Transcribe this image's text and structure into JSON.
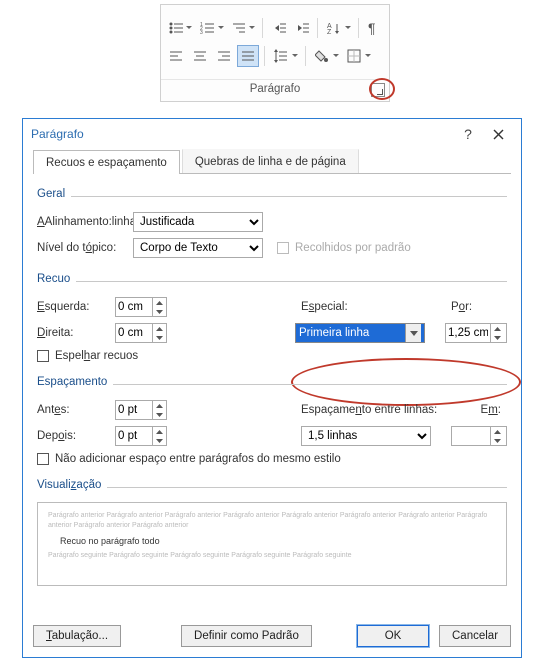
{
  "ribbon": {
    "group_label": "Parágrafo"
  },
  "dialog": {
    "title": "Parágrafo",
    "tabs": {
      "indent": "Recuos e espaçamento",
      "breaks": "Quebras de linha e de página"
    },
    "general": {
      "label": "Geral",
      "align_label": "Alinhamento:",
      "align_value": "Justificada",
      "outline_label": "Nível do tópico:",
      "outline_value": "Corpo de Texto",
      "collapsed_label": "Recolhidos por padrão"
    },
    "indent": {
      "label": "Recuo",
      "left_label": "Esquerda:",
      "left_value": "0 cm",
      "right_label": "Direita:",
      "right_value": "0 cm",
      "special_label": "Especial:",
      "special_value": "Primeira linha",
      "by_label": "Por:",
      "by_value": "1,25 cm",
      "mirror_label": "Espelhar recuos"
    },
    "spacing": {
      "label": "Espaçamento",
      "before_label": "Antes:",
      "before_value": "0 pt",
      "after_label": "Depois:",
      "after_value": "0 pt",
      "line_label": "Espaçamento entre linhas:",
      "line_value": "1,5 linhas",
      "at_label": "Em:",
      "at_value": "",
      "no_space_label": "Não adicionar espaço entre parágrafos do mesmo estilo"
    },
    "preview": {
      "label": "Visualização",
      "prev_text": "Parágrafo anterior Parágrafo anterior Parágrafo anterior Parágrafo anterior Parágrafo anterior Parágrafo anterior Parágrafo anterior Parágrafo anterior Parágrafo anterior Parágrafo anterior",
      "body_text": "Recuo no parágrafo todo",
      "next_text": "Parágrafo seguinte Parágrafo seguinte Parágrafo seguinte Parágrafo seguinte Parágrafo seguinte"
    },
    "buttons": {
      "tabs": "Tabulação...",
      "default": "Definir como Padrão",
      "ok": "OK",
      "cancel": "Cancelar"
    }
  }
}
